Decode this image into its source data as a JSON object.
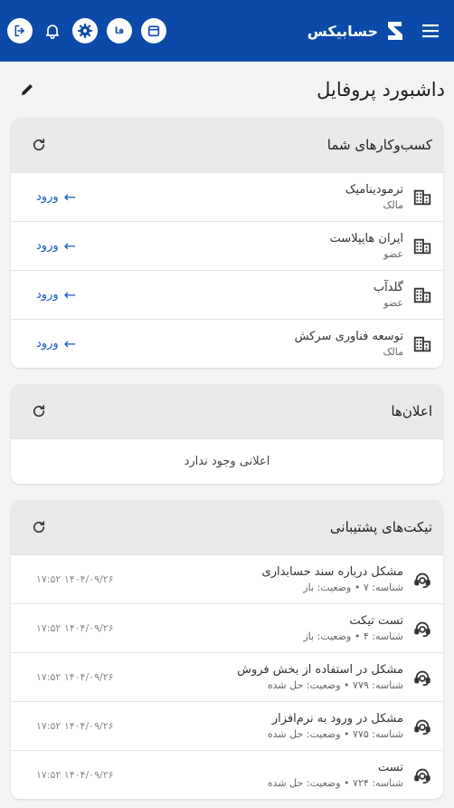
{
  "appbar": {
    "brand": "حسابیکس",
    "lang_badge": "فا"
  },
  "page": {
    "title": "داشبورد پروفایل"
  },
  "businesses": {
    "title": "کسب‌وکارهای شما",
    "enter_label": "ورود",
    "items": [
      {
        "name": "ترمودینامیک",
        "role": "مالک"
      },
      {
        "name": "ایران هایپلاست",
        "role": "عضو"
      },
      {
        "name": "گلدآب",
        "role": "عضو"
      },
      {
        "name": "توسعه فناوری سرکش",
        "role": "مالک"
      }
    ]
  },
  "announcements": {
    "title": "اعلان‌ها",
    "empty_text": "اعلانی وجود ندارد"
  },
  "tickets": {
    "title": "تیکت‌های پشتیبانی",
    "items": [
      {
        "title": "مشکل درباره سند حسابداری",
        "meta": "شناسه: ۷ • وضعیت: باز",
        "time": "۱۷:۵۲ ۱۴۰۴/۰۹/۲۶"
      },
      {
        "title": "تست تیکت",
        "meta": "شناسه: ۴ • وضعیت: باز",
        "time": "۱۷:۵۲ ۱۴۰۴/۰۹/۲۶"
      },
      {
        "title": "مشکل در استفاده از بخش فروش",
        "meta": "شناسه: ۷۷۹ • وضعیت: حل شده",
        "time": "۱۷:۵۲ ۱۴۰۴/۰۹/۲۶"
      },
      {
        "title": "مشکل در ورود به نرم‌افزار",
        "meta": "شناسه: ۷۷۵ • وضعیت: حل شده",
        "time": "۱۷:۵۲ ۱۴۰۴/۰۹/۲۶"
      },
      {
        "title": "تست",
        "meta": "شناسه: ۷۲۴ • وضعیت: حل شده",
        "time": "۱۷:۵۲ ۱۴۰۴/۰۹/۲۶"
      }
    ]
  },
  "colors": {
    "appbar": "#0b4aa8",
    "link": "#1558c0"
  }
}
